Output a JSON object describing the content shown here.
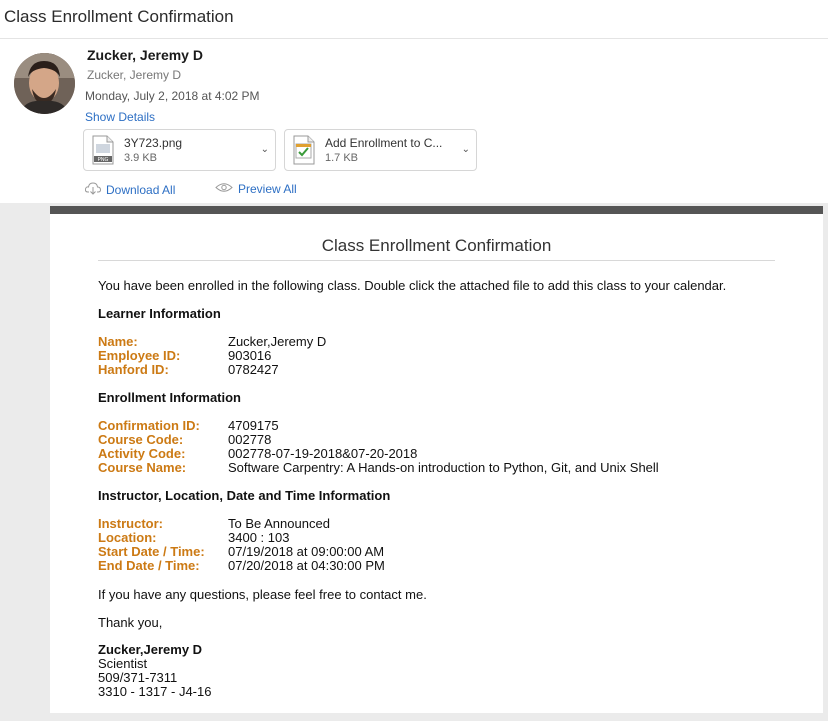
{
  "subject": "Class Enrollment Confirmation",
  "sender": {
    "name": "Zucker, Jeremy D",
    "address": "Zucker, Jeremy D",
    "date": "Monday, July 2, 2018 at 4:02 PM",
    "show_details": "Show Details"
  },
  "attachments": [
    {
      "name": "3Y723.png",
      "size": "3.9 KB",
      "icon": "png-file-icon"
    },
    {
      "name": "Add Enrollment to C...",
      "size": "1.7 KB",
      "icon": "calendar-file-icon"
    }
  ],
  "actions": {
    "download_all": "Download All",
    "preview_all": "Preview All"
  },
  "email": {
    "title": "Class Enrollment Confirmation",
    "intro": "You have been enrolled in the following class. Double click the attached file to add this class to your calendar.",
    "learner": {
      "heading": "Learner Information",
      "name_label": "Name:",
      "name_value": "Zucker,Jeremy D",
      "employee_label": "Employee ID:",
      "employee_value": "903016",
      "hanford_label": "Hanford ID:",
      "hanford_value": "0782427"
    },
    "enrollment": {
      "heading": "Enrollment Information",
      "confirmation_label": "Confirmation ID:",
      "confirmation_value": "4709175",
      "course_code_label": "Course Code:",
      "course_code_value": "002778",
      "activity_label": "Activity Code:",
      "activity_value": "002778-07-19-2018&07-20-2018",
      "course_name_label": "Course Name:",
      "course_name_value": "Software Carpentry: A Hands-on introduction to Python, Git, and Unix Shell"
    },
    "instructor": {
      "heading": "Instructor, Location, Date and Time Information",
      "instructor_label": "Instructor:",
      "instructor_value": "To Be Announced",
      "location_label": "Location:",
      "location_value": "3400 : 103",
      "start_label": "Start Date / Time:",
      "start_value": "07/19/2018 at 09:00:00 AM",
      "end_label": "End Date / Time:",
      "end_value": "07/20/2018 at 04:30:00 PM"
    },
    "questions": "If you have any questions, please feel free to contact me.",
    "thanks": "Thank you,",
    "signature": {
      "name": "Zucker,Jeremy D",
      "title": "Scientist",
      "phone": "509/371-7311",
      "office": "3310 - 1317 - J4-16"
    }
  },
  "colors": {
    "label_orange": "#cc7a14",
    "link_blue": "#2d6fc4",
    "bar_gray": "#555555"
  }
}
